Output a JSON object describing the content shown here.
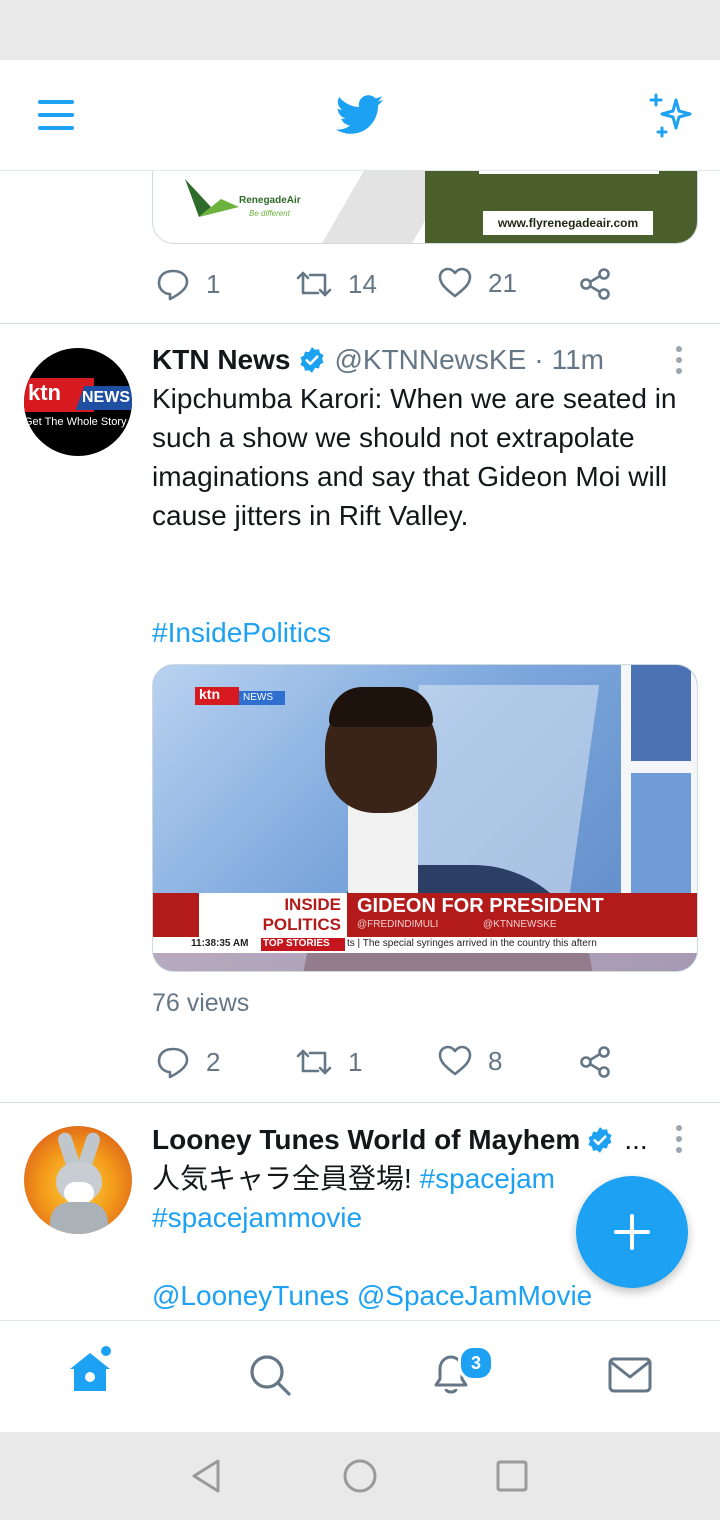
{
  "colors": {
    "accent": "#1da1f2",
    "text": "#14171a",
    "muted": "#657786"
  },
  "header": {
    "logo_icon": "twitter-bird-icon",
    "menu_icon": "hamburger-menu-icon",
    "sparkle_icon": "sparkle-icon"
  },
  "prev_tweet": {
    "ad_brand": "RenegadeAir",
    "ad_tagline": "Be different",
    "ad_url": "www.flyrenegadeair.com",
    "replies": "1",
    "retweets": "14",
    "likes": "21"
  },
  "tweet1": {
    "name": "KTN News",
    "handle": "@KTNNewsKE",
    "dot": "·",
    "time": "11m",
    "avatar_logo": "ktn",
    "avatar_news": "NEWS",
    "avatar_tagline": "Get The Whole Story",
    "text": "Kipchumba Karori: When we are seated in such a show we should not extrapolate imaginations and say that Gideon Moi will cause jitters in Rift Valley.",
    "hashtag": "#InsidePolitics",
    "media": {
      "logo": "ktn",
      "logo_news": "NEWS",
      "show_line1": "INSIDE",
      "show_line2": "POLITICS",
      "headline": "GIDEON FOR PRESIDENT",
      "sub1": "@FREDINDIMULI",
      "sub2": "@KTNNEWSKE",
      "ticker_time": "11:38:35 AM",
      "ticker_tag": "TOP STORIES",
      "ticker_text": "ts | The special syringes arrived in the country this aftern"
    },
    "views": "76 views",
    "replies": "2",
    "retweets": "1",
    "likes": "8"
  },
  "tweet2": {
    "name": "Looney Tunes World of Mayhem",
    "ellipsis": "...",
    "text_jp": "人気キャラ全員登場!",
    "tag1": "#spacejam",
    "tag2": "#spacejammovie",
    "mentions": "@LooneyTunes @SpaceJamMovie"
  },
  "bottom_nav": {
    "notifications_badge": "3"
  }
}
